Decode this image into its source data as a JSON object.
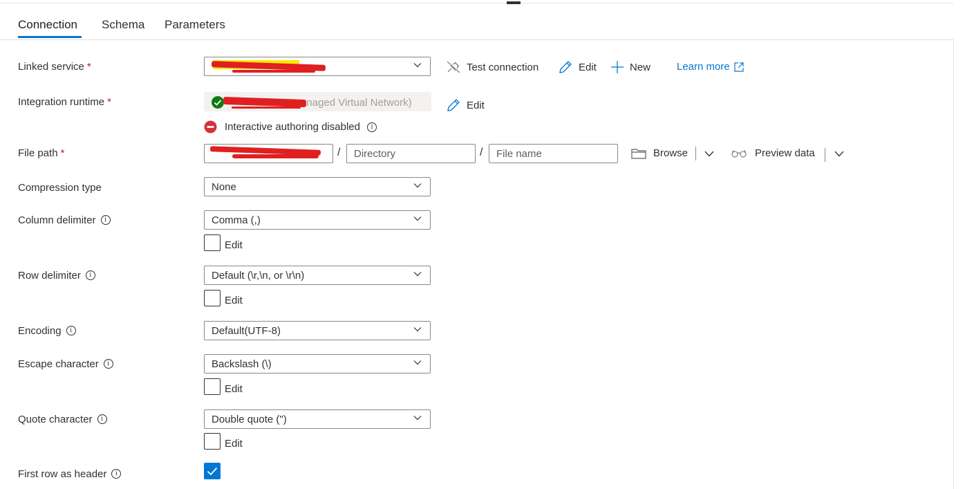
{
  "tabs": [
    {
      "label": "Connection",
      "active": true
    },
    {
      "label": "Schema",
      "active": false
    },
    {
      "label": "Parameters",
      "active": false
    }
  ],
  "linked_service": {
    "label": "Linked service",
    "required": "*",
    "value": "",
    "actions": {
      "test_connection": "Test connection",
      "edit": "Edit",
      "new": "New",
      "learn_more": "Learn more"
    }
  },
  "integration_runtime": {
    "label": "Integration runtime",
    "required": "*",
    "value_visible": "anaged Virtual Network)",
    "edit": "Edit",
    "status_text": "Interactive authoring disabled"
  },
  "file_path": {
    "label": "File path",
    "required": "*",
    "container_value": "",
    "directory_placeholder": "Directory",
    "file_name_placeholder": "File name",
    "separator": "/",
    "browse": "Browse",
    "preview_data": "Preview data"
  },
  "compression_type": {
    "label": "Compression type",
    "value": "None"
  },
  "column_delimiter": {
    "label": "Column delimiter",
    "value": "Comma (,)",
    "edit_label": "Edit"
  },
  "row_delimiter": {
    "label": "Row delimiter",
    "value": "Default (\\r,\\n, or \\r\\n)",
    "edit_label": "Edit"
  },
  "encoding": {
    "label": "Encoding",
    "value": "Default(UTF-8)"
  },
  "escape_character": {
    "label": "Escape character",
    "value": "Backslash (\\)",
    "edit_label": "Edit"
  },
  "quote_character": {
    "label": "Quote character",
    "value": "Double quote (\")",
    "edit_label": "Edit"
  },
  "first_row_as_header": {
    "label": "First row as header",
    "checked": true
  },
  "colors": {
    "accent": "#0078d4",
    "required": "#a4262c",
    "error": "#d13438",
    "success": "#107c10",
    "redaction": "#e02020"
  }
}
